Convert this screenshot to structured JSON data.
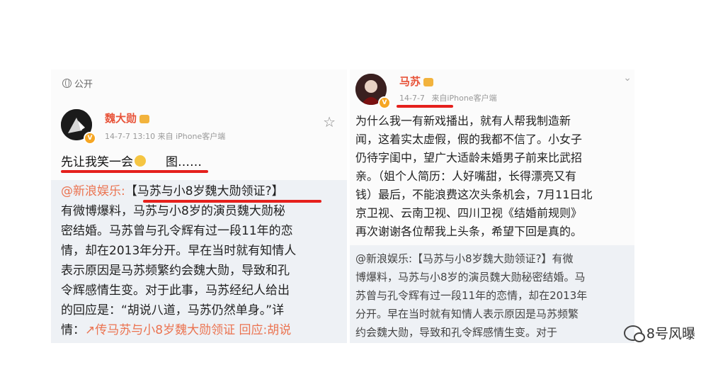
{
  "left_post": {
    "visibility": "公开",
    "author": "魏大勋",
    "meta": "14-7-7 13:10  来自 iPhone客户端",
    "headline_before": "先让我笑一会",
    "headline_after": "图……",
    "repost_source": "@新浪娱乐:",
    "repost_title": "【马苏与小8岁魏大勋领证?】",
    "body_lines": [
      "有微博爆料，马苏与小8岁的演员魏大勋秘",
      "密结婚。马苏曾与孔令辉有过一段11年的恋",
      "情，却在2013年分开。早在当时就有知情人",
      "表示原因是马苏频繁约会魏大勋，导致和孔",
      "令辉感情生变。对于此事，马苏经纪人给出",
      "的回应是：“胡说八道，马苏仍然单身。”详"
    ],
    "last_line_prefix": "情：",
    "last_line_link": "传马苏与小8岁魏大勋领证",
    "last_line_suffix": "回应:胡说"
  },
  "right_post": {
    "author": "马苏",
    "date": "14-7-7",
    "source": "来自iPhone客户端",
    "body_lines": [
      "为什么我一有新戏播出，就有人帮我制造新",
      "闻，这着实太虚假，假的我都不信了。小女子",
      "仍待字闺中，望广大适龄未婚男子前来比武招",
      "亲。（姐个人简历：人好嘴甜，长得漂亮又有",
      "钱）最后，不能浪费这次头条机会，7月11日北",
      "京卫视、云南卫视、四川卫视《结婚前规则》",
      "再次谢谢各位帮我上头条，希望下回是真的。"
    ],
    "repost_lines": [
      "@新浪娱乐:【马苏与小8岁魏大勋领证?】有微",
      "博爆料，马苏与小8岁的演员魏大勋秘密结婚。马",
      "苏曾与孔令辉有过一段11年的恋情，却在2013年",
      "分开。早在当时就有知情人表示原因是马苏频繁",
      "约会魏大勋，导致和孔令辉感情生变。对于"
    ]
  },
  "watermark": "8号风曝",
  "colors": {
    "accent_red": "#e5201c",
    "author_name": "#e8543a",
    "link": "#eb7350"
  }
}
